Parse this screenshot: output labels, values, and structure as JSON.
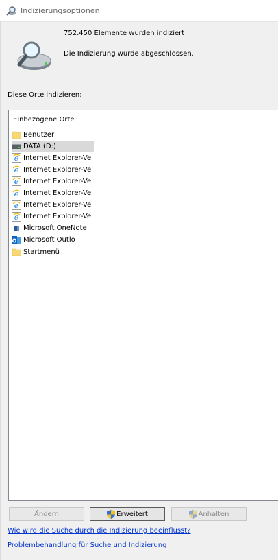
{
  "window": {
    "title": "Indizierungsoptionen",
    "icon": "indexing-magnifier-icon"
  },
  "status": {
    "indexed_count": "752.450 Elemente wurden indiziert",
    "state": "Die Indizierung wurde abgeschlossen."
  },
  "locations": {
    "section_label": "Diese Orte indizieren:",
    "header": "Einbezogene Orte",
    "items": [
      {
        "label": "Benutzer",
        "icon": "folder-icon",
        "selected": false
      },
      {
        "label": "DATA (D:)",
        "icon": "drive-icon",
        "selected": true
      },
      {
        "label": "Internet Explorer-Ve",
        "icon": "internet-explorer-icon",
        "selected": false
      },
      {
        "label": "Internet Explorer-Ve",
        "icon": "internet-explorer-icon",
        "selected": false
      },
      {
        "label": "Internet Explorer-Ve",
        "icon": "internet-explorer-icon",
        "selected": false
      },
      {
        "label": "Internet Explorer-Ve",
        "icon": "internet-explorer-icon",
        "selected": false
      },
      {
        "label": "Internet Explorer-Ve",
        "icon": "internet-explorer-icon",
        "selected": false
      },
      {
        "label": "Internet Explorer-Ve",
        "icon": "internet-explorer-icon",
        "selected": false
      },
      {
        "label": "Microsoft OneNote",
        "icon": "onenote-icon",
        "selected": false
      },
      {
        "label": "Microsoft Outlo",
        "icon": "outlook-icon",
        "selected": false
      },
      {
        "label": "Startmenü",
        "icon": "folder-icon",
        "selected": false
      }
    ]
  },
  "buttons": {
    "change": "Ändern",
    "advanced": "Erweitert",
    "pause": "Anhalten"
  },
  "links": {
    "how_affects": "Wie wird die Suche durch die Indizierung beeinflusst?",
    "troubleshoot": "Problembehandlung für Suche und Indizierung"
  },
  "colors": {
    "link": "#0033cc",
    "selection": "#d9d9d9",
    "folder": "#f8d775"
  }
}
